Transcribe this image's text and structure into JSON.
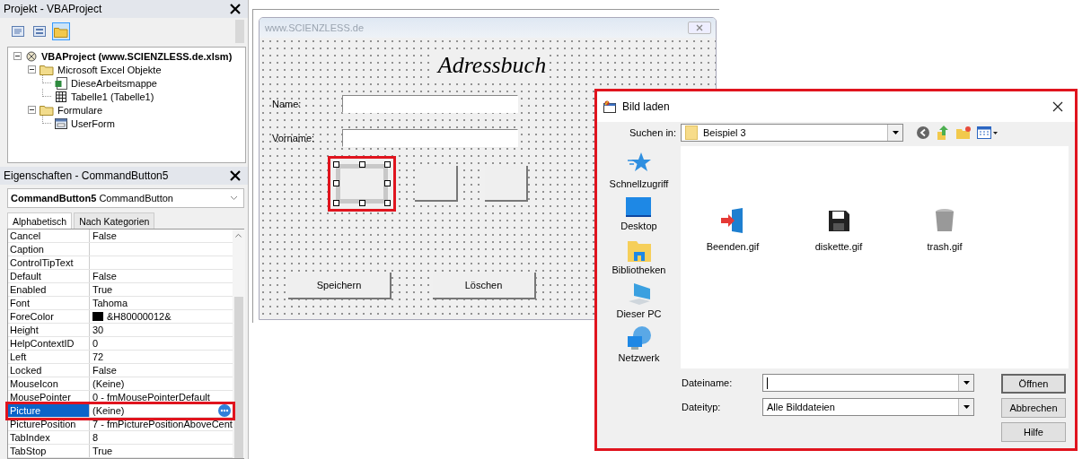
{
  "project_panel": {
    "title": "Projekt - VBAProject",
    "toolbar": [
      {
        "kind": "code",
        "selected": false
      },
      {
        "kind": "object",
        "selected": false
      },
      {
        "kind": "folders",
        "selected": true
      }
    ],
    "tree": [
      {
        "label": "VBAProject (www.SCIENZLESS.de.xlsm)",
        "kind": "project",
        "expanded": true,
        "children": [
          {
            "label": "Microsoft Excel Objekte",
            "kind": "folder",
            "expanded": true,
            "children": [
              {
                "label": "DieseArbeitsmappe",
                "kind": "workbook"
              },
              {
                "label": "Tabelle1 (Tabelle1)",
                "kind": "sheet"
              }
            ]
          },
          {
            "label": "Formulare",
            "kind": "folder",
            "expanded": true,
            "children": [
              {
                "label": "UserForm",
                "kind": "form"
              }
            ]
          }
        ]
      }
    ]
  },
  "properties_panel": {
    "title": "Eigenschaften - CommandButton5",
    "object_select": "**CommandButton5** CommandButton",
    "tabs": [
      {
        "label": "Alphabetisch",
        "selected": true
      },
      {
        "label": "Nach Kategorien",
        "selected": false
      }
    ],
    "rows": [
      {
        "name": "Cancel",
        "value": "False",
        "selected": false,
        "highlighted": false
      },
      {
        "name": "Caption",
        "selected": false,
        "highlighted": false
      },
      {
        "name": "ControlTipText",
        "selected": false,
        "highlighted": false
      },
      {
        "name": "Default",
        "value": "False",
        "selected": false,
        "highlighted": false
      },
      {
        "name": "Enabled",
        "value": "True",
        "selected": false,
        "highlighted": false
      },
      {
        "name": "Font",
        "value": "Tahoma",
        "selected": false,
        "highlighted": false
      },
      {
        "name": "ForeColor",
        "value": "&H80000012&",
        "color": "#000000",
        "selected": false,
        "highlighted": false
      },
      {
        "name": "Height",
        "value": "30",
        "selected": false,
        "highlighted": false
      },
      {
        "name": "HelpContextID",
        "value": "0",
        "selected": false,
        "highlighted": false
      },
      {
        "name": "Left",
        "value": "72",
        "selected": false,
        "highlighted": false
      },
      {
        "name": "Locked",
        "value": "False",
        "selected": false,
        "highlighted": false
      },
      {
        "name": "MouseIcon",
        "value": "(Keine)",
        "selected": false,
        "highlighted": false
      },
      {
        "name": "MousePointer",
        "value": "0 - fmMousePointerDefault",
        "selected": false,
        "highlighted": false
      },
      {
        "name": "Picture",
        "value": "(Keine)",
        "selected": true,
        "highlighted": true
      },
      {
        "name": "PicturePosition",
        "value": "7 - fmPicturePositionAboveCent",
        "selected": false,
        "highlighted": false
      },
      {
        "name": "TabIndex",
        "value": "8",
        "selected": false,
        "highlighted": false
      },
      {
        "name": "TabStop",
        "value": "True",
        "selected": false,
        "highlighted": false
      }
    ]
  },
  "userform": {
    "title": "www.SCIENZLESS.de",
    "heading": "Adressbuch",
    "fields": [
      {
        "label": "Name:"
      },
      {
        "label": "Vorname:"
      }
    ],
    "image_buttons": [
      {
        "selected": true,
        "highlighted": true
      },
      {
        "selected": false,
        "highlighted": false
      },
      {
        "selected": false,
        "highlighted": false
      }
    ],
    "buttons": [
      "Speichern",
      "Löschen"
    ]
  },
  "dialog": {
    "title": "Bild laden",
    "highlighted": true,
    "look_in": {
      "label": "Suchen in:",
      "value": "Beispiel 3"
    },
    "places": [
      {
        "label": "Schnellzugriff",
        "kind": "star"
      },
      {
        "label": "Desktop",
        "kind": "desktop"
      },
      {
        "label": "Bibliotheken",
        "kind": "library"
      },
      {
        "label": "Dieser PC",
        "kind": "pc"
      },
      {
        "label": "Netzwerk",
        "kind": "network"
      }
    ],
    "files": [
      {
        "name": "Beenden.gif",
        "kind": "exit"
      },
      {
        "name": "diskette.gif",
        "kind": "disk"
      },
      {
        "name": "trash.gif",
        "kind": "trash"
      }
    ],
    "filename": {
      "label": "Dateiname:"
    },
    "filetype": {
      "label": "Dateityp:",
      "value": "Alle Bilddateien"
    },
    "buttons": [
      {
        "label": "Öffnen",
        "default": true
      },
      {
        "label": "Abbrechen",
        "default": false
      },
      {
        "label": "Hilfe",
        "default": false
      }
    ]
  }
}
